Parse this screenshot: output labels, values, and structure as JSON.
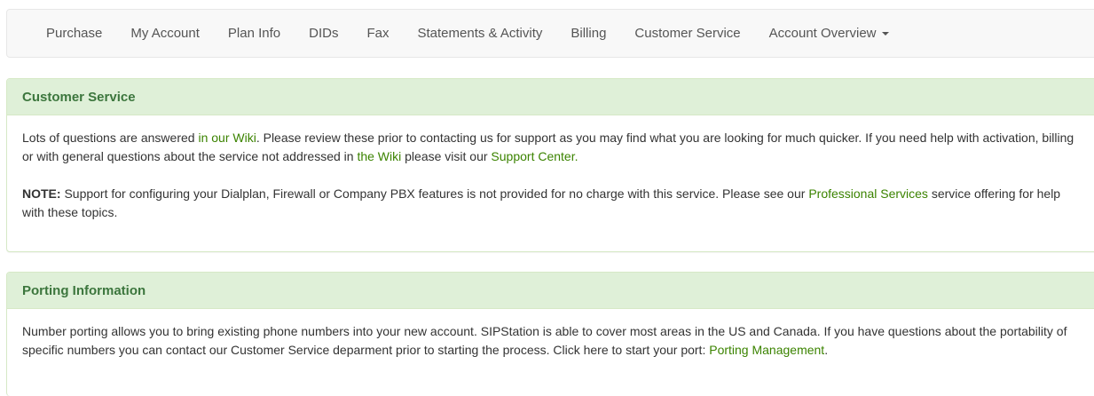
{
  "nav": {
    "items": [
      {
        "label": "Purchase"
      },
      {
        "label": "My Account"
      },
      {
        "label": "Plan Info"
      },
      {
        "label": "DIDs"
      },
      {
        "label": "Fax"
      },
      {
        "label": "Statements & Activity"
      },
      {
        "label": "Billing"
      },
      {
        "label": "Customer Service"
      },
      {
        "label": "Account Overview"
      }
    ]
  },
  "customer_service": {
    "title": "Customer Service",
    "p1": {
      "t1": "Lots of questions are answered ",
      "link1": "in our Wiki",
      "t2": ". Please review these prior to contacting us for support as you may find what you are looking for much quicker. If you need help with activation, billing or with general questions about the service not addressed in ",
      "link2": "the Wiki",
      "t3": " please visit our ",
      "link3": "Support Center.",
      "t4": ""
    },
    "p2": {
      "note_label": "NOTE:",
      "t1": " Support for configuring your Dialplan, Firewall or Company PBX features is not provided for no charge with this service. Please see our ",
      "link1": "Professional Services",
      "t2": " service offering for help with these topics."
    }
  },
  "porting": {
    "title": "Porting Information",
    "p1": {
      "t1": "Number porting allows you to bring existing phone numbers into your new account. SIPStation is able to cover most areas in the US and Canada. If you have questions about the portability of specific numbers you can contact our Customer Service deparment prior to starting the process. Click here to start your port: ",
      "link1": "Porting Management",
      "t2": "."
    }
  },
  "colors": {
    "panel_heading_bg": "#dff0d8",
    "panel_heading_text": "#3c763d",
    "link": "#3b8300",
    "navbar_bg": "#f8f8f8"
  },
  "icons": {
    "dropdown": "caret-down-icon"
  }
}
